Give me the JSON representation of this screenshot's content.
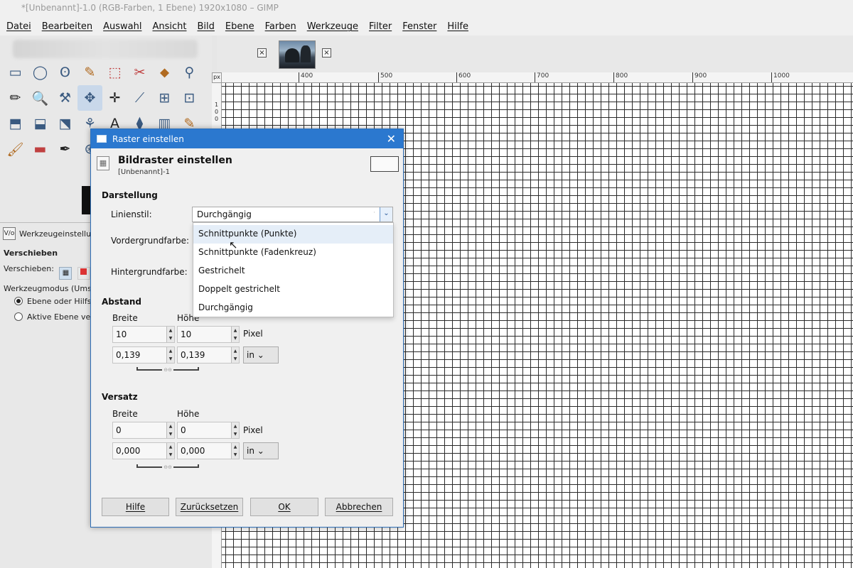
{
  "window": {
    "title": "*[Unbenannt]-1.0 (RGB-Farben, 1 Ebene) 1920x1080 – GIMP"
  },
  "menu": [
    "Datei",
    "Bearbeiten",
    "Auswahl",
    "Ansicht",
    "Bild",
    "Ebene",
    "Farben",
    "Werkzeuge",
    "Filter",
    "Fenster",
    "Hilfe"
  ],
  "tabs": {
    "close_glyph": "×"
  },
  "ruler": {
    "corner": "px",
    "ticks": [
      "400",
      "500",
      "600",
      "700",
      "800",
      "900",
      "1000"
    ],
    "vertical_digits": [
      "1",
      "0",
      "0"
    ]
  },
  "toolbox": {
    "tools": [
      "▭",
      "◯",
      "ʘ",
      "✎",
      "⬚",
      "✂",
      "⬥",
      "⚲",
      "✏",
      "🔍",
      "⚒",
      "✥",
      "✛",
      "⟋",
      "⊞",
      "⊡",
      "⬒",
      "⬓",
      "⬔",
      "⚘",
      "A",
      "⧫",
      "▥",
      "✎",
      "🖌",
      "▬",
      "✒",
      "⊛",
      "⊕",
      "⊗",
      "☍",
      "●"
    ],
    "options_tab_label": "Werkzeugeinstellun",
    "options_tab_icon": "V/o",
    "tool_name": "Verschieben",
    "move_label": "Verschieben:",
    "mode_label": "Werkzeugmodus (Umsch",
    "radio_1": "Ebene oder Hilfslin",
    "radio_2": "Aktive Ebene vers"
  },
  "dialog": {
    "title": "Raster einstellen",
    "close": "✕",
    "heading": "Bildraster einstellen",
    "subheading": "[Unbenannt]-1",
    "darstellung": {
      "section": "Darstellung",
      "linienstil_label": "Linienstil:",
      "linienstil_value": "Durchgängig",
      "dropdown_arrow": "⌄",
      "vordergrund_label": "Vordergrundfarbe:",
      "hintergrund_label": "Hintergrundfarbe:",
      "options": [
        "Schnittpunkte (Punkte)",
        "Schnittpunkte (Fadenkreuz)",
        "Gestrichelt",
        "Doppelt gestrichelt",
        "Durchgängig"
      ]
    },
    "abstand": {
      "section": "Abstand",
      "breite_label": "Breite",
      "hoehe_label": "Höhe",
      "breite_px": "10",
      "hoehe_px": "10",
      "px_unit": "Pixel",
      "breite_in": "0,139",
      "hoehe_in": "0,139",
      "in_unit": "in ⌄"
    },
    "versatz": {
      "section": "Versatz",
      "breite_label": "Breite",
      "hoehe_label": "Höhe",
      "breite_px": "0",
      "hoehe_px": "0",
      "px_unit": "Pixel",
      "breite_in": "0,000",
      "hoehe_in": "0,000",
      "in_unit": "in ⌄"
    },
    "buttons": {
      "hilfe": "Hilfe",
      "reset": "Zurücksetzen",
      "ok": "OK",
      "cancel": "Abbrechen"
    }
  }
}
